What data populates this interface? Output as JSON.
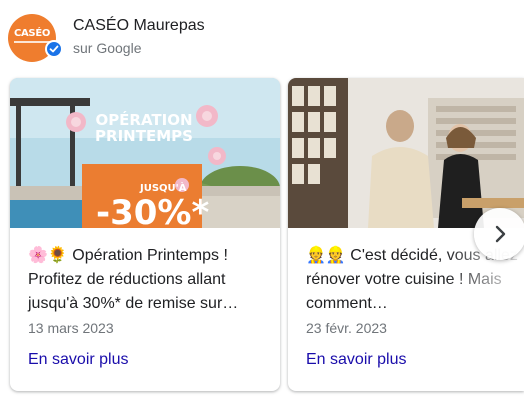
{
  "business": {
    "name": "CASÉO Maurepas",
    "source": "sur Google",
    "logo_text": "CASÉO"
  },
  "posts": [
    {
      "image": {
        "title": "OPÉRATION PRINTEMPS",
        "jusqua": "JUSQU'À",
        "discount": "-30%*"
      },
      "text_line1": "🌸🌻 Opération Printemps !",
      "text_line2": "Profitez de réductions allant",
      "text_line3": "jusqu'à 30%* de remise sur…",
      "date": "13 mars 2023",
      "link": "En savoir plus"
    },
    {
      "text_line1": "👷👷 C'est décidé, vous allez",
      "text_line2": "rénover votre cuisine ! Mais",
      "text_line3": "comment…",
      "date": "23 févr. 2023",
      "link": "En savoir plus"
    }
  ],
  "colors": {
    "brand_orange": "#ef7d2e",
    "link": "#1a0dab",
    "verified": "#1a73e8"
  },
  "icons": {
    "verified": "verified-check-icon",
    "next": "chevron-right-icon"
  }
}
